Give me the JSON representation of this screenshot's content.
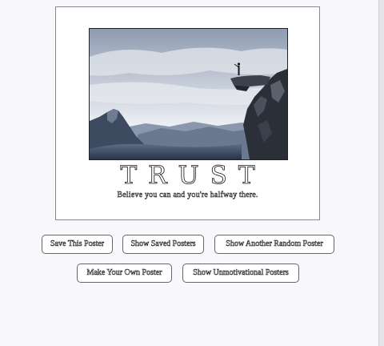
{
  "poster": {
    "title": "TRUST",
    "subtitle": "Believe you can and you're halfway there."
  },
  "buttons": {
    "save_poster": "Save This Poster",
    "show_saved": "Show Saved Posters",
    "show_random": "Show Another Random Poster",
    "make_own": "Make Your Own Poster",
    "show_unmotivational": "Show Unmotivational Posters"
  },
  "colors": {
    "page_background": "#f7f7fc",
    "poster_background": "#ffffff",
    "button_background": "#ffffff",
    "text_outline": "#111111"
  }
}
